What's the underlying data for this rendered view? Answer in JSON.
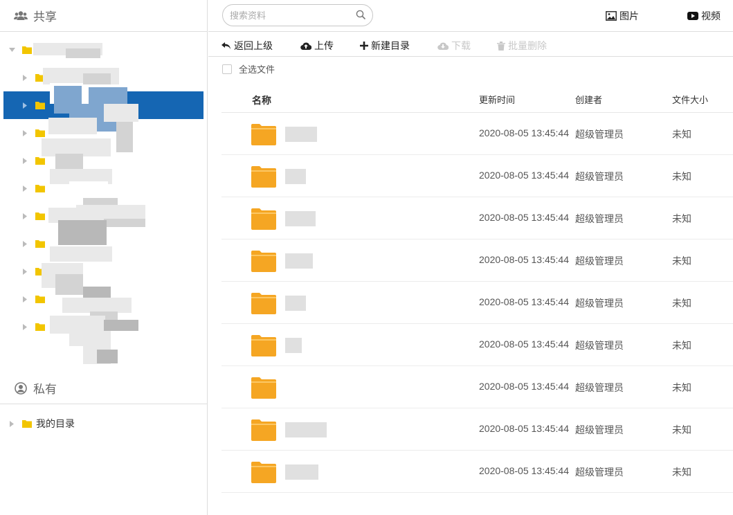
{
  "sidebar": {
    "shared_title": "共享",
    "private_title": "私有",
    "private_items": [
      {
        "label": "我的目录"
      }
    ]
  },
  "search": {
    "placeholder": "搜索资料"
  },
  "media": {
    "images_label": "图片",
    "videos_label": "视频"
  },
  "toolbar": {
    "back_label": "返回上级",
    "upload_label": "上传",
    "new_dir_label": "新建目录",
    "download_label": "下载",
    "batch_delete_label": "批量删除"
  },
  "select_all_label": "全选文件",
  "table": {
    "headers": {
      "name": "名称",
      "updated": "更新时间",
      "creator": "创建者",
      "size": "文件大小"
    },
    "rows": [
      {
        "updated": "2020-08-05 13:45:44",
        "creator": "超级管理员",
        "size": "未知"
      },
      {
        "updated": "2020-08-05 13:45:44",
        "creator": "超级管理员",
        "size": "未知"
      },
      {
        "updated": "2020-08-05 13:45:44",
        "creator": "超级管理员",
        "size": "未知"
      },
      {
        "updated": "2020-08-05 13:45:44",
        "creator": "超级管理员",
        "size": "未知"
      },
      {
        "updated": "2020-08-05 13:45:44",
        "creator": "超级管理员",
        "size": "未知"
      },
      {
        "updated": "2020-08-05 13:45:44",
        "creator": "超级管理员",
        "size": "未知"
      },
      {
        "updated": "2020-08-05 13:45:44",
        "creator": "超级管理员",
        "size": "未知"
      },
      {
        "updated": "2020-08-05 13:45:44",
        "creator": "超级管理员",
        "size": "未知"
      },
      {
        "updated": "2020-08-05 13:45:44",
        "creator": "超级管理员",
        "size": "未知"
      }
    ]
  },
  "colors": {
    "accent": "#1566b3",
    "folder": "#f5a623",
    "tree_folder": "#f2c500"
  },
  "icons": {
    "shared": "users-icon",
    "private": "user-circle-icon",
    "search": "search-icon",
    "images": "image-icon",
    "videos": "play-icon",
    "back": "undo-icon",
    "upload": "cloud-upload-icon",
    "new_dir": "plus-icon",
    "download": "cloud-download-icon",
    "batch_delete": "trash-icon",
    "folder": "folder-icon"
  }
}
